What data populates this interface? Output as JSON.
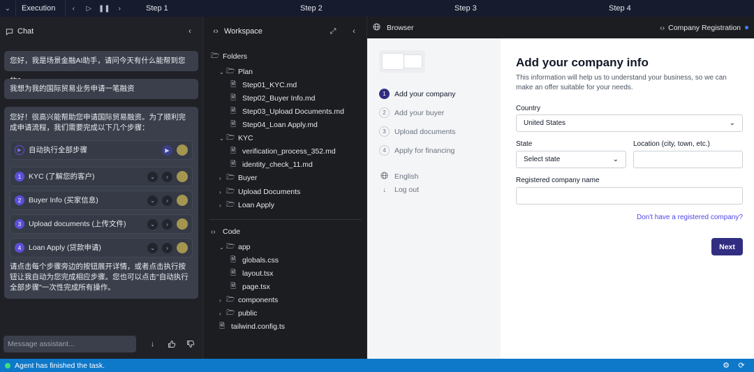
{
  "topbar": {
    "execution_label": "Execution",
    "steps": [
      "Step 1",
      "Step 2",
      "Step 3",
      "Step 4"
    ]
  },
  "chat": {
    "title": "Chat",
    "messages": {
      "assistant_greeting": "您好，我是场景金融AI助手，请问今天有什么能帮到您的?",
      "user_request": "我想为我的国际贸易业务申请一笔融资",
      "assistant_reply_intro": "您好！很高兴能帮助您申请国际贸易融资。为了顺利完成申请流程，我们需要完成以下几个步骤：",
      "run_all_label": "自动执行全部步骤",
      "steps": [
        {
          "num": "1",
          "label": "KYC (了解您的客户)"
        },
        {
          "num": "2",
          "label": "Buyer Info (买家信息)"
        },
        {
          "num": "3",
          "label": "Upload documents (上传文件)"
        },
        {
          "num": "4",
          "label": "Loan Apply (贷款申请)"
        }
      ],
      "assistant_reply_outro": "请点击每个步骤旁边的按钮展开详情，或者点击执行按钮让我自动为您完成相应步骤。您也可以点击\"自动执行全部步骤\"一次性完成所有操作。"
    },
    "input_placeholder": "Message assistant..."
  },
  "workspace": {
    "title": "Workspace",
    "folders_label": "Folders",
    "plan": "Plan",
    "plan_files": [
      "Step01_KYC.md",
      "Step02_Buyer Info.md",
      "Step03_Upload Documents.md",
      "Step04_Loan Apply.md"
    ],
    "kyc": "KYC",
    "kyc_files": [
      "verification_process_352.md",
      "identity_check_11.md"
    ],
    "buyer": "Buyer",
    "upload_docs": "Upload Documents",
    "loan_apply": "Loan Apply",
    "code_label": "Code",
    "app": "app",
    "app_files": [
      "globals.css",
      "layout.tsx",
      "page.tsx"
    ],
    "components": "components",
    "public": "public",
    "tailwind": "tailwind.config.ts"
  },
  "browser": {
    "title": "Browser",
    "tab_title": "Company Registration",
    "sidebar": {
      "steps": [
        {
          "num": "1",
          "label": "Add your company"
        },
        {
          "num": "2",
          "label": "Add your buyer"
        },
        {
          "num": "3",
          "label": "Upload documents"
        },
        {
          "num": "4",
          "label": "Apply for financing"
        }
      ],
      "language": "English",
      "logout": "Log out"
    },
    "form": {
      "title": "Add your company info",
      "description": "This information will help us to understand your business, so we can make an offer suitable for your needs.",
      "country_label": "Country",
      "country_value": "United States",
      "state_label": "State",
      "state_value": "Select state",
      "location_label": "Location (city, town, etc.)",
      "location_value": "",
      "company_name_label": "Registered company name",
      "company_name_value": "",
      "no_company_link": "Don't have a registered company?",
      "next_label": "Next"
    }
  },
  "status": {
    "text": "Agent has finished the task."
  }
}
